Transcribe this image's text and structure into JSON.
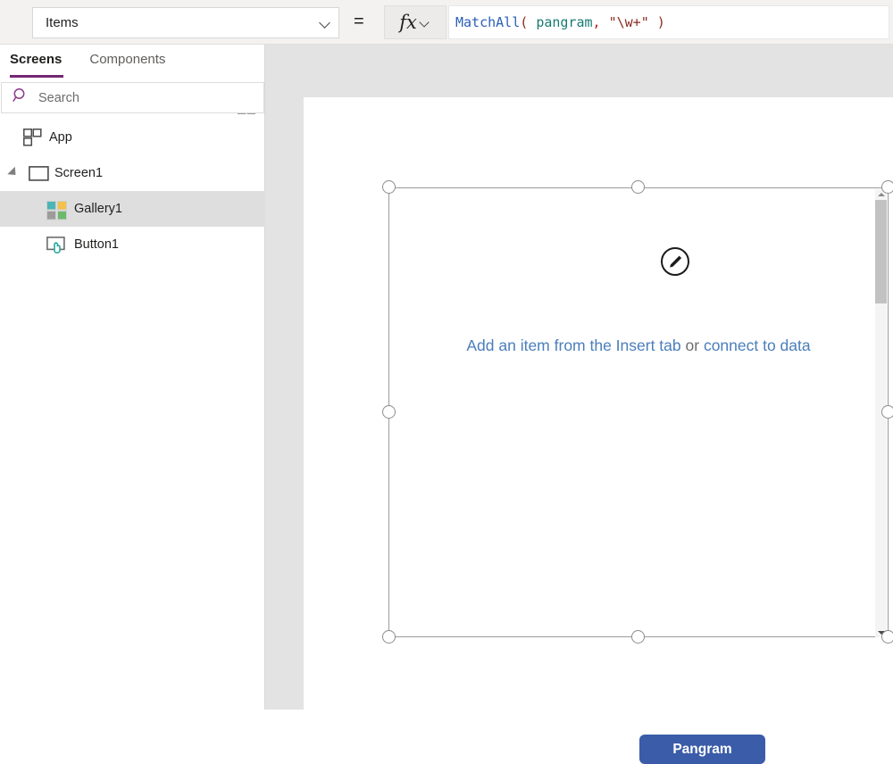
{
  "formula_bar": {
    "property_selector": {
      "value": "Items",
      "icon": "chevron-down-icon"
    },
    "equals": "=",
    "fx_button": {
      "label": "fx",
      "icon": "chevron-down-icon"
    },
    "formula": {
      "full_text": "MatchAll( pangram, \"\\w+\" )",
      "tokens": [
        {
          "text": "MatchAll",
          "kind": "function"
        },
        {
          "text": "( ",
          "kind": "paren"
        },
        {
          "text": "pangram",
          "kind": "identifier"
        },
        {
          "text": ",",
          "kind": "comma"
        },
        {
          "text": " ",
          "kind": "plain"
        },
        {
          "text": "\"\\w+\"",
          "kind": "string"
        },
        {
          "text": " )",
          "kind": "paren"
        }
      ]
    }
  },
  "left_panel": {
    "tabs": [
      {
        "label": "Screens",
        "active": true
      },
      {
        "label": "Components",
        "active": false
      }
    ],
    "view_icons": [
      {
        "name": "tree-view-icon",
        "active": true
      },
      {
        "name": "thumbnail-view-icon",
        "active": false
      }
    ],
    "search": {
      "placeholder": "Search",
      "value": "",
      "icon": "search-icon"
    },
    "tree": [
      {
        "label": "App",
        "icon": "app-icon",
        "depth": 0,
        "selected": false,
        "expandable": false
      },
      {
        "label": "Screen1",
        "icon": "screen-icon",
        "depth": 0,
        "selected": false,
        "expandable": true,
        "expanded": true
      },
      {
        "label": "Gallery1",
        "icon": "gallery-icon",
        "depth": 1,
        "selected": true,
        "expandable": false
      },
      {
        "label": "Button1",
        "icon": "button-icon",
        "depth": 1,
        "selected": false,
        "expandable": false
      }
    ]
  },
  "canvas": {
    "gallery": {
      "empty_prefix": "Add an item from the Insert tab",
      "empty_middle": " or ",
      "empty_suffix": "connect to data",
      "edit_badge_icon": "pencil-icon",
      "selected": true
    },
    "button": {
      "label": "Pangram"
    }
  },
  "colors": {
    "accent_purple": "#742774",
    "link_blue": "#4a7ebb",
    "button_blue": "#3b5ca8",
    "selection_gray": "#9b9b9b",
    "panel_bg": "#ffffff",
    "workspace_bg": "#e3e3e3",
    "toolbar_bg": "#f3f2f1"
  }
}
